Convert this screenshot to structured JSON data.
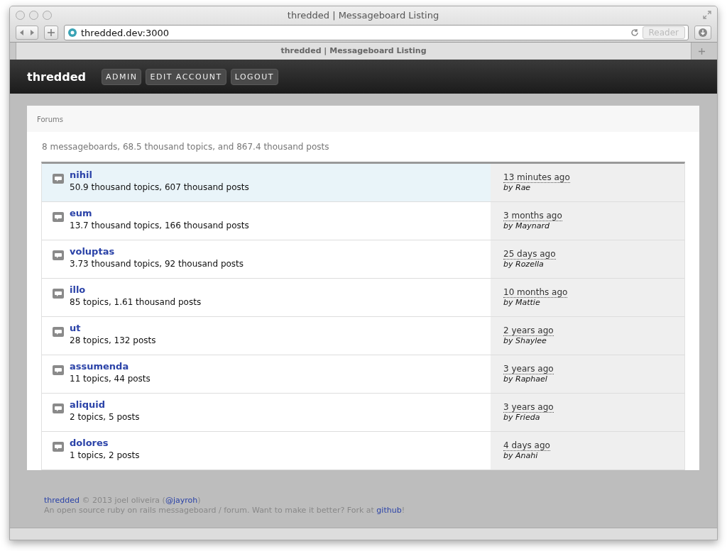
{
  "window": {
    "title": "thredded | Messageboard Listing"
  },
  "toolbar": {
    "url": "thredded.dev:3000",
    "reader_button": "Reader"
  },
  "tabs": [
    {
      "label": "thredded | Messageboard Listing",
      "selected": true
    }
  ],
  "nav": {
    "brand": "thredded",
    "buttons": [
      "ADMIN",
      "EDIT ACCOUNT",
      "LOGOUT"
    ]
  },
  "breadcrumb": "Forums",
  "summary": "8 messageboards, 68.5 thousand topics, and 867.4 thousand posts",
  "boards": [
    {
      "name": "nihil",
      "stats": "50.9 thousand topics, 607 thousand posts",
      "time": "13 minutes ago",
      "author": "by Rae",
      "selected": true
    },
    {
      "name": "eum",
      "stats": "13.7 thousand topics, 166 thousand posts",
      "time": "3 months ago",
      "author": "by Maynard",
      "selected": false
    },
    {
      "name": "voluptas",
      "stats": "3.73 thousand topics, 92 thousand posts",
      "time": "25 days ago",
      "author": "by Rozella",
      "selected": false
    },
    {
      "name": "illo",
      "stats": "85 topics, 1.61 thousand posts",
      "time": "10 months ago",
      "author": "by Mattie",
      "selected": false
    },
    {
      "name": "ut",
      "stats": "28 topics, 132 posts",
      "time": "2 years ago",
      "author": "by Shaylee",
      "selected": false
    },
    {
      "name": "assumenda",
      "stats": "11 topics, 44 posts",
      "time": "3 years ago",
      "author": "by Raphael",
      "selected": false
    },
    {
      "name": "aliquid",
      "stats": "2 topics, 5 posts",
      "time": "3 years ago",
      "author": "by Frieda",
      "selected": false
    },
    {
      "name": "dolores",
      "stats": "1 topics, 2 posts",
      "time": "4 days ago",
      "author": "by Anahi",
      "selected": false
    }
  ],
  "footer": [
    [
      {
        "text": "thredded",
        "link": true
      },
      {
        "text": " © 2013 joel oliveira (",
        "link": false
      },
      {
        "text": "@jayroh",
        "link": true
      },
      {
        "text": ")",
        "link": false
      }
    ],
    [
      {
        "text": "An open source ruby on rails messageboard / forum. Want to make it better? Fork at ",
        "link": false
      },
      {
        "text": "github",
        "link": true
      },
      {
        "text": "!",
        "link": false
      }
    ]
  ]
}
